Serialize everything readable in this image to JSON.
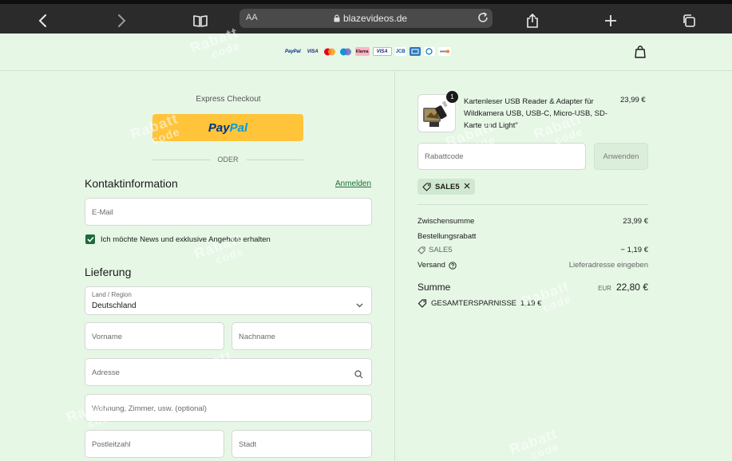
{
  "browser": {
    "text_size_label": "AA",
    "url": "blazevideos.de"
  },
  "header": {
    "payment_logos": [
      "PayPal",
      "VISA",
      "Mastercard",
      "Maestro",
      "Klarna",
      "VISA",
      "JCB",
      "AMEX",
      "Diners",
      "Discover"
    ]
  },
  "checkout": {
    "express_label": "Express Checkout",
    "paypal_label_a": "Pay",
    "paypal_label_b": "Pal",
    "separator": "ODER",
    "contact_title": "Kontaktinformation",
    "login_link": "Anmelden",
    "email_placeholder": "E-Mail",
    "newsletter_label": "Ich möchte News und exklusive Angebote erhalten",
    "delivery_title": "Lieferung",
    "country_label": "Land / Region",
    "country_value": "Deutschland",
    "firstname_placeholder": "Vorname",
    "lastname_placeholder": "Nachname",
    "address_placeholder": "Adresse",
    "apartment_placeholder": "Wohnung, Zimmer, usw. (optional)",
    "zip_placeholder": "Postleitzahl",
    "city_placeholder": "Stadt"
  },
  "summary": {
    "product_qty": "1",
    "product_name": "Kartenleser USB Reader & Adapter für Wildkamera USB, USB-C, Micro-USB, SD-Karte und Light\"",
    "product_price": "23,99 €",
    "discount_placeholder": "Rabattcode",
    "apply_label": "Anwenden",
    "applied_code": "SALE5",
    "subtotal_label": "Zwischensumme",
    "subtotal_value": "23,99 €",
    "order_discount_label": "Bestellungsrabatt",
    "order_discount_code": "SALE5",
    "order_discount_value": "− 1,19 €",
    "shipping_label": "Versand",
    "shipping_value": "Lieferadresse eingeben",
    "total_label": "Summe",
    "total_currency": "EUR",
    "total_value": "22,80 €",
    "savings_label": "GESAMTERSPARNISSE",
    "savings_value": "1,19 €"
  },
  "watermark": {
    "line1": "Rabatt",
    "line2": "code"
  },
  "colors": {
    "page_bg": "#e6f7e6",
    "accent": "#1d6b3a",
    "paypal_yellow": "#ffc439"
  }
}
